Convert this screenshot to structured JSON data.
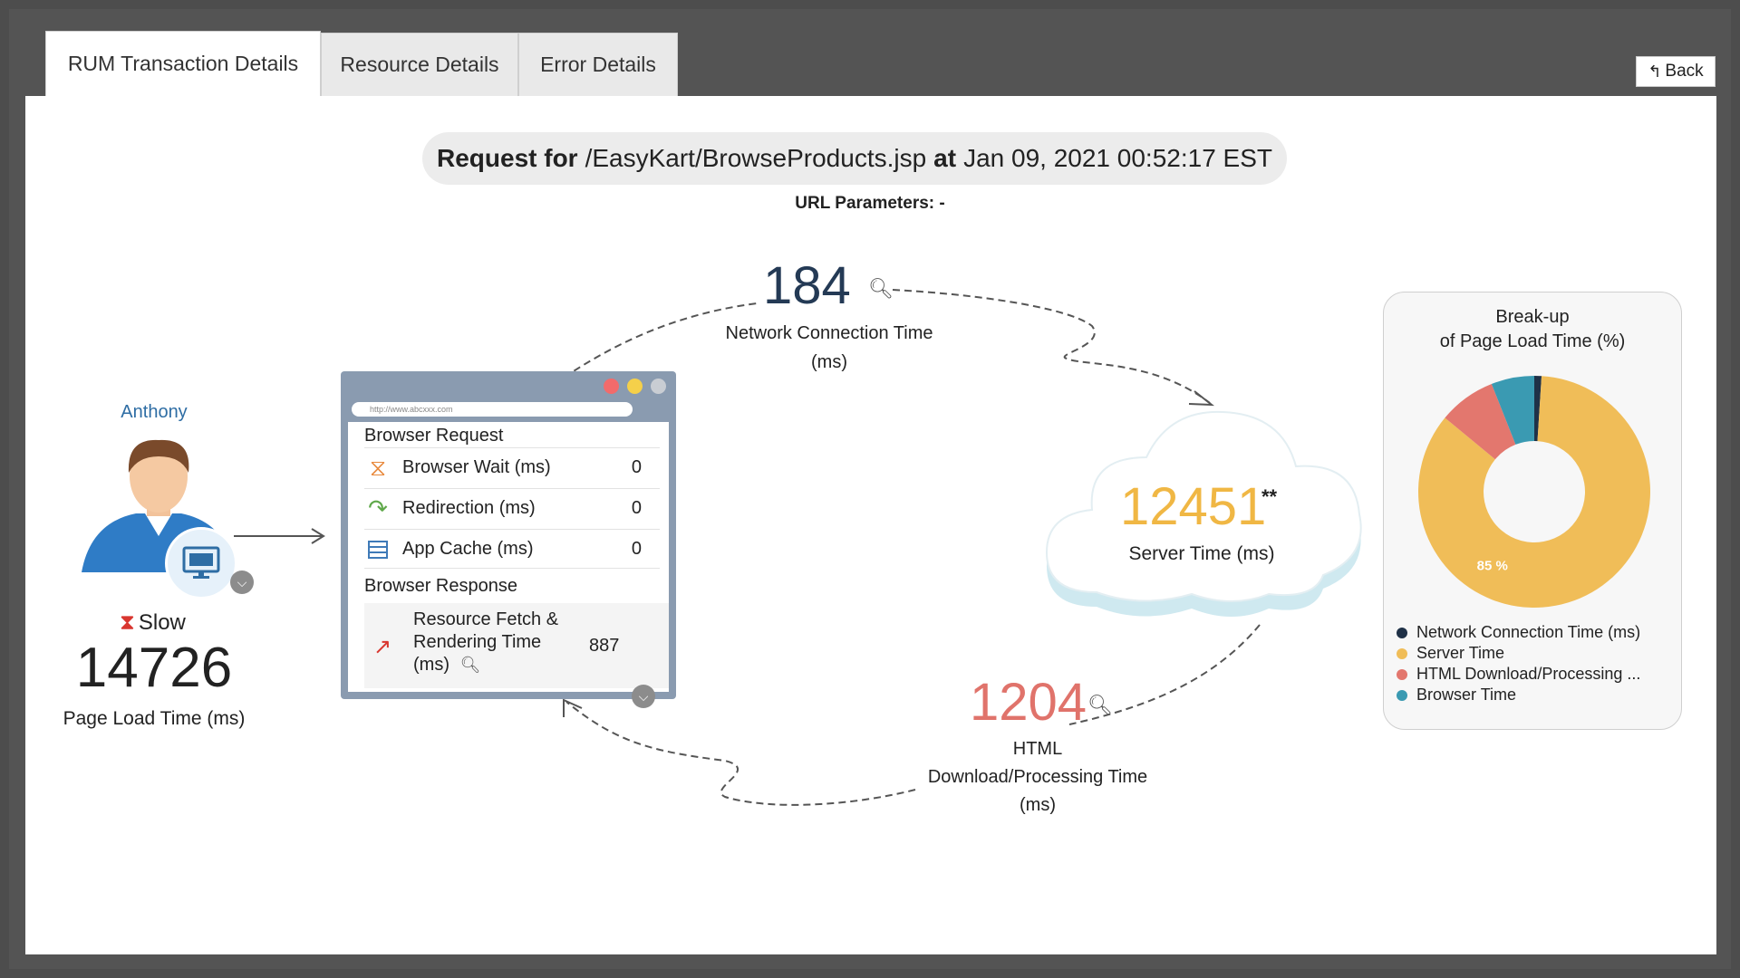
{
  "tabs": [
    {
      "label": "RUM Transaction Details"
    },
    {
      "label": "Resource Details"
    },
    {
      "label": "Error Details"
    }
  ],
  "back_label": "Back",
  "request": {
    "prefix": "Request for",
    "url": "/EasyKart/BrowseProducts.jsp",
    "at": "at",
    "timestamp": "Jan 09, 2021 00:52:17 EST"
  },
  "url_parameters": "URL Parameters: -",
  "user": {
    "name": "Anthony",
    "status": "Slow",
    "page_load_time": "14726",
    "page_load_label": "Page Load Time (ms)"
  },
  "browser": {
    "address": "http://www.abcxxx.com",
    "request_title": "Browser Request",
    "rows": [
      {
        "label": "Browser Wait (ms)",
        "value": "0"
      },
      {
        "label": "Redirection (ms)",
        "value": "0"
      },
      {
        "label": "App Cache (ms)",
        "value": "0"
      }
    ],
    "response_title": "Browser Response",
    "fetch_line1": "Resource Fetch &",
    "fetch_line2": "Rendering Time",
    "fetch_line3": "(ms)",
    "fetch_value": "887"
  },
  "network": {
    "value": "184",
    "label_line1": "Network Connection Time",
    "label_line2": "(ms)"
  },
  "server": {
    "value": "12451",
    "marker": "**",
    "label": "Server Time (ms)"
  },
  "html_download": {
    "value": "1204",
    "label_line1": "HTML",
    "label_line2": "Download/Processing Time",
    "label_line3": "(ms)"
  },
  "breakup": {
    "title_line1": "Break-up",
    "title_line2": "of Page Load Time (%)"
  },
  "chart_data": {
    "type": "pie",
    "title": "Break-up of Page Load Time (%)",
    "labels": [
      "Network Connection Time (ms)",
      "Server Time",
      "HTML Download/Processing ...",
      "Browser Time"
    ],
    "values": [
      1,
      85,
      8,
      6
    ],
    "colors": [
      "#1f3147",
      "#f0bd58",
      "#e3776e",
      "#3a9ab2"
    ],
    "data_labels": [
      "",
      "85 %",
      "",
      ""
    ]
  },
  "colors": {
    "network": "#243a55",
    "server": "#f0b744",
    "html": "#e0736b",
    "link": "#2e6da4"
  }
}
